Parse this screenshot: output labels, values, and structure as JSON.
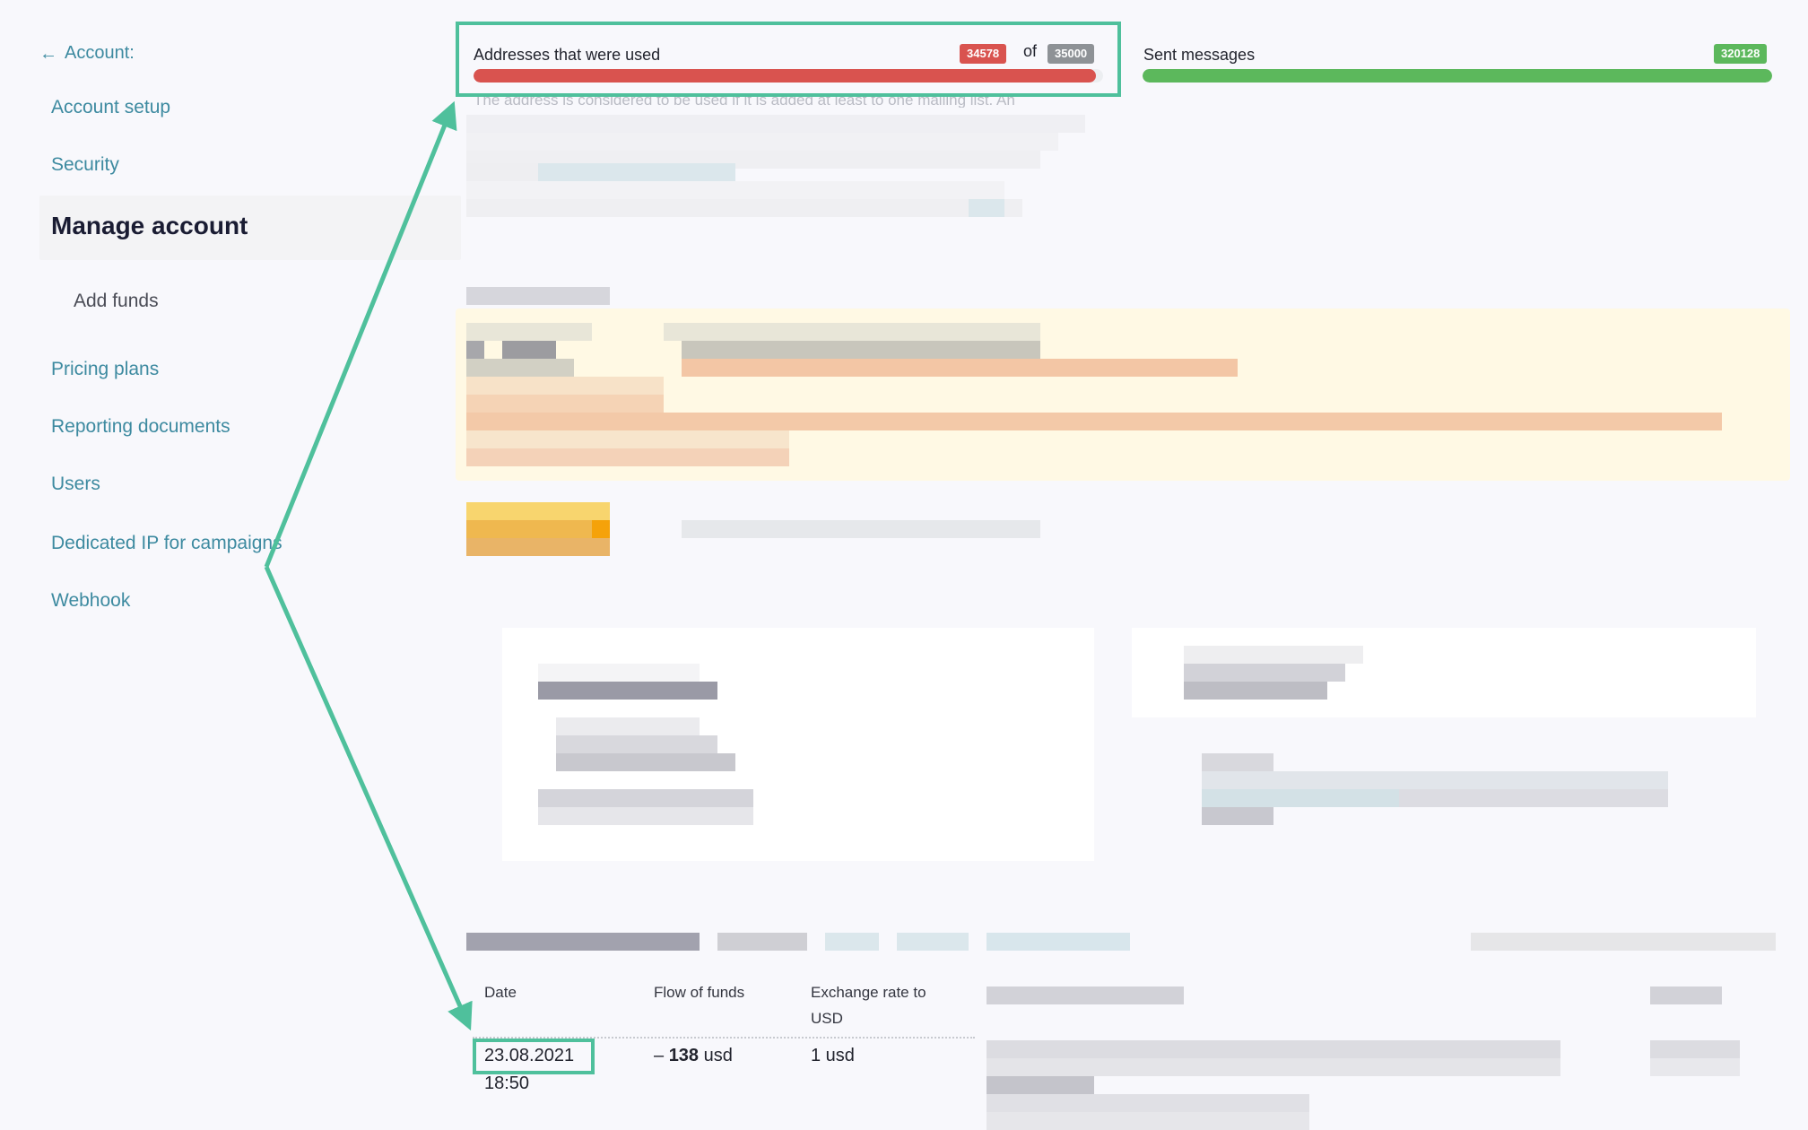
{
  "sidebar": {
    "back_label": "Account:",
    "back_icon": "arrow-left-icon",
    "items": [
      {
        "label": "Account setup"
      },
      {
        "label": "Security"
      },
      {
        "label": "Manage account",
        "active": true
      },
      {
        "label": "Add funds",
        "sub": true
      },
      {
        "label": "Pricing plans"
      },
      {
        "label": "Reporting documents"
      },
      {
        "label": "Users"
      },
      {
        "label": "Dedicated IP for campaigns"
      },
      {
        "label": "Webhook"
      }
    ]
  },
  "usage": {
    "addresses": {
      "label": "Addresses that were used",
      "used": "34578",
      "of_label": "of",
      "limit": "35000",
      "fill_fraction": 0.988,
      "color": "#d9534f",
      "hint": "The address is considered to be used if it is added at least to one mailing list. An"
    },
    "sent": {
      "label": "Sent messages",
      "count": "320128",
      "fill_fraction": 1.0,
      "color": "#5cb85c"
    }
  },
  "transactions": {
    "columns": [
      "Date",
      "Flow of funds",
      "Exchange rate to USD"
    ],
    "rows": [
      {
        "date": "23.08.2021",
        "time": "18:50",
        "flow_sign": "–",
        "flow_amount": "138",
        "flow_unit": "usd",
        "rate": "1 usd"
      }
    ]
  },
  "annotation": {
    "color": "#4fc09c"
  },
  "redacted_note": "pixelated"
}
